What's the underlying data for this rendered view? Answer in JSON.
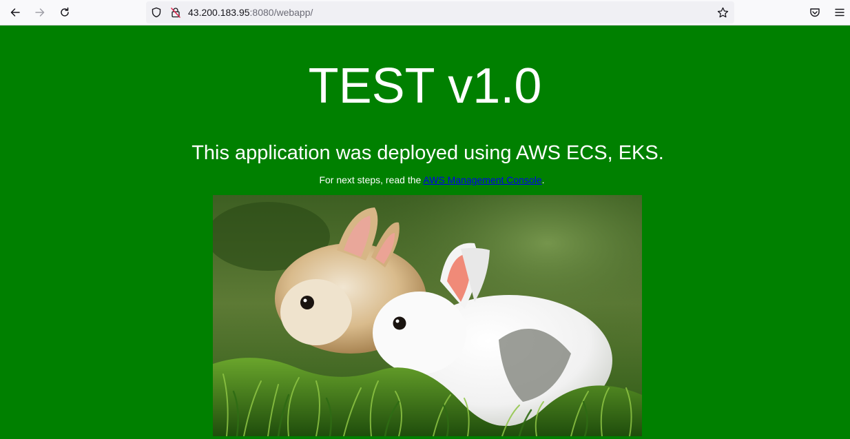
{
  "browser": {
    "url_host": "43.200.183.95",
    "url_rest": ":8080/webapp/",
    "icons": {
      "back": "back-arrow-icon",
      "forward": "forward-arrow-icon",
      "reload": "reload-icon",
      "tracking_protection": "shield-icon",
      "connection": "insecure-lock-icon",
      "bookmark": "star-icon",
      "pocket": "pocket-icon",
      "menu": "hamburger-menu-icon"
    }
  },
  "page": {
    "title": "TEST v1.0",
    "subtitle": "This application was deployed using AWS ECS, EKS.",
    "next_steps_prefix": "For next steps, read the ",
    "next_steps_link": "AWS Management Console",
    "next_steps_suffix": ".",
    "background_color": "#008000",
    "link_color": "#0000ee"
  }
}
